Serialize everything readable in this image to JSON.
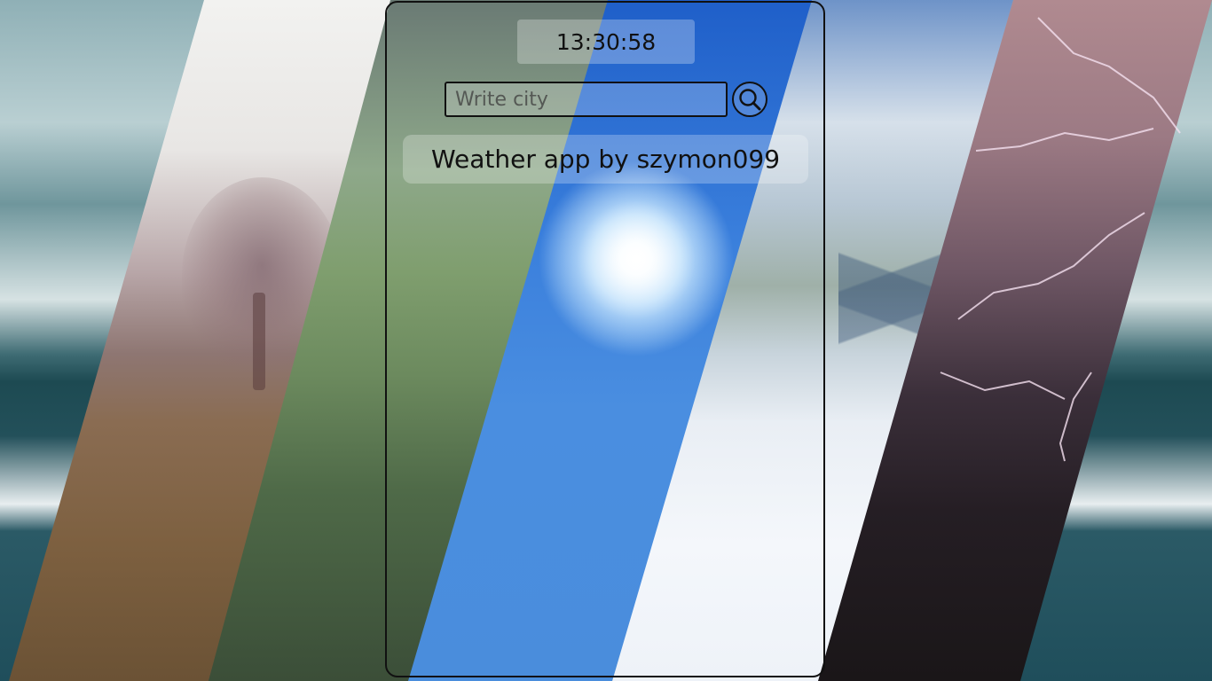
{
  "app": {
    "clock": "13:30:58",
    "search": {
      "placeholder": "Write city",
      "value": ""
    },
    "title": "Weather app by szymon099"
  },
  "background": {
    "stripes": [
      "sea",
      "fog",
      "rain",
      "sun",
      "snow",
      "storm"
    ]
  },
  "icons": {
    "search": "magnifier-icon"
  },
  "colors": {
    "panel_border": "#111111",
    "text": "#111111"
  }
}
